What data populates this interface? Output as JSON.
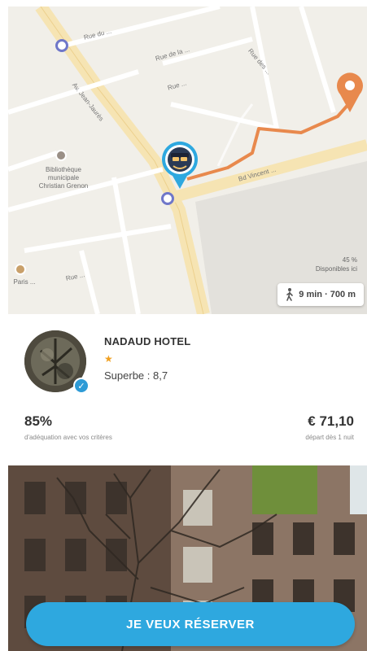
{
  "map": {
    "streets": [
      "Rue du ...",
      "Av. Jean-Jaurès",
      "Rue de la ...",
      "Rue ...",
      "Rue des ...",
      "Bd Vincent ...",
      "Rue ..."
    ],
    "pois": [
      {
        "name": "Bibliothèque municipale\nChristian Grenon"
      },
      {
        "name": "Paris ..."
      }
    ],
    "meta_line1": "45 %",
    "meta_line2": "Disponibles ici",
    "walk": {
      "icon": "walking-person-icon",
      "text": "9 min · 700 m"
    }
  },
  "hotel": {
    "name": "NADAUD HOTEL",
    "stars": "★",
    "rating": "Superbe : 8,7",
    "photo_icon": "hotel-photo",
    "badge_icon": "verified-check-icon"
  },
  "stats": {
    "percent": "85%",
    "percent_caption": "d'adéquation avec vos critères",
    "price": "€ 71,10",
    "price_caption": "départ dès 1 nuit"
  },
  "cta": {
    "label": "JE VEUX RÉSERVER"
  },
  "colors": {
    "accent": "#2ea8df",
    "route": "#e8894d",
    "star": "#f0a021",
    "metro": "#6f77c9"
  }
}
